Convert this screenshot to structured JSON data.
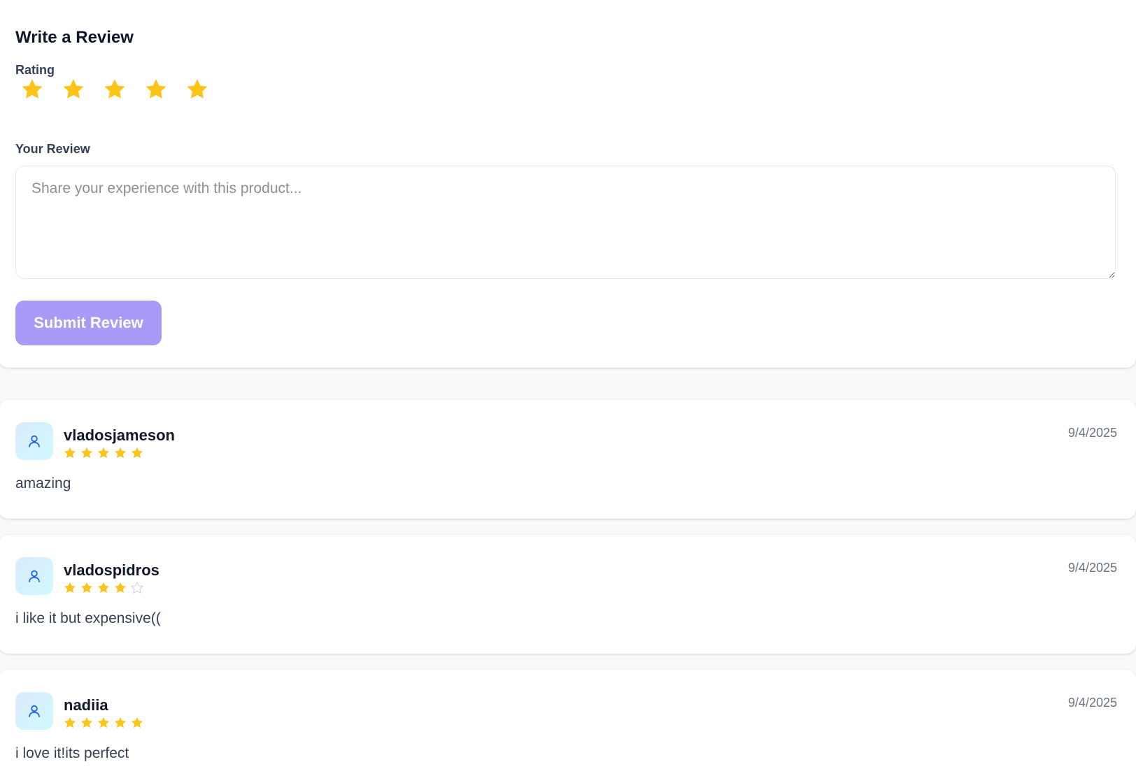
{
  "write_review": {
    "title": "Write a Review",
    "rating_label": "Rating",
    "rating": {
      "selected": 5,
      "max": 5
    },
    "review_label": "Your Review",
    "review_value": "",
    "review_placeholder": "Share your experience with this product...",
    "submit_label": "Submit Review",
    "submit_color": "#a79bf7"
  },
  "colors": {
    "star_filled": "#fcc419",
    "star_empty": "#d1d5db",
    "avatar_icon": "#2563eb"
  },
  "icons": {
    "rating_star": "star-icon",
    "avatar": "user-icon"
  },
  "reviews": [
    {
      "username": "vladosjameson",
      "rating": 5,
      "date": "9/4/2025",
      "text": "amazing"
    },
    {
      "username": "vladospidros",
      "rating": 4,
      "date": "9/4/2025",
      "text": "i like it but expensive(("
    },
    {
      "username": "nadiia",
      "rating": 5,
      "date": "9/4/2025",
      "text": "i love it!its perfect"
    }
  ]
}
